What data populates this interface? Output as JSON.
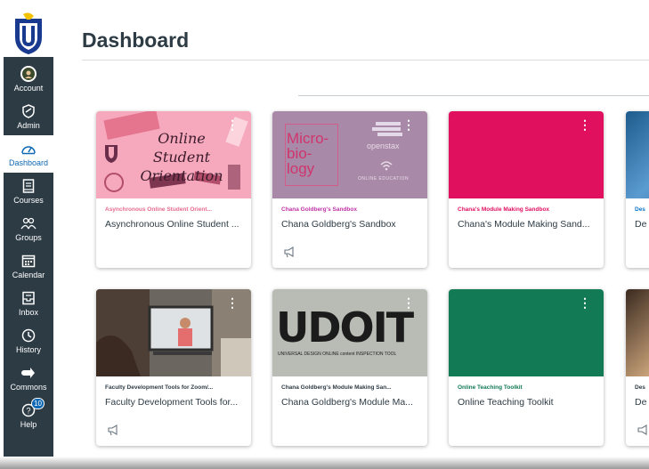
{
  "nav": {
    "items": [
      {
        "label": "Account",
        "icon": "avatar-icon"
      },
      {
        "label": "Admin",
        "icon": "shield-icon"
      },
      {
        "label": "Dashboard",
        "icon": "gauge-icon"
      },
      {
        "label": "Courses",
        "icon": "book-icon"
      },
      {
        "label": "Groups",
        "icon": "people-icon"
      },
      {
        "label": "Calendar",
        "icon": "calendar-icon"
      },
      {
        "label": "Inbox",
        "icon": "inbox-icon"
      },
      {
        "label": "History",
        "icon": "clock-icon"
      },
      {
        "label": "Commons",
        "icon": "commons-icon"
      },
      {
        "label": "Help",
        "icon": "help-icon",
        "badge": "10"
      }
    ]
  },
  "header": {
    "title": "Dashboard"
  },
  "cards": [
    {
      "code": "Asynchronous Online Student Orient...",
      "name": "Asynchronous Online Student ...",
      "color": "#e56b8f",
      "hero_text": [
        "Online Student",
        "Orientation"
      ]
    },
    {
      "code": "Chana Goldberg's Sandbox",
      "name": "Chana Goldberg's Sandbox",
      "color": "#bf32a4",
      "hero_text": [
        "Micro-",
        "bio-",
        "logy",
        "openstax",
        "ONLINE EDUCATION"
      ]
    },
    {
      "code": "Chana's Module Making Sandbox",
      "name": "Chana's Module Making Sand...",
      "color": "#e0105f"
    },
    {
      "code": "Des",
      "name": "De",
      "color": "#0b74c8"
    },
    {
      "code": "Faculty Development Tools for Zoom/...",
      "name": "Faculty Development Tools for...",
      "color": "#2d3b45"
    },
    {
      "code": "Chana Goldberg's Module Making San...",
      "name": "Chana Goldberg's Module Ma...",
      "color": "#2d3b45",
      "hero_text": [
        "UDOIT",
        "UNIVERSAL DESIGN ONLINE content INSPECTION TOOL"
      ]
    },
    {
      "code": "Online Teaching Toolkit",
      "name": "Online Teaching Toolkit",
      "color": "#127a55"
    },
    {
      "code": "Des",
      "name": "De",
      "color": "#2d3b45"
    }
  ]
}
